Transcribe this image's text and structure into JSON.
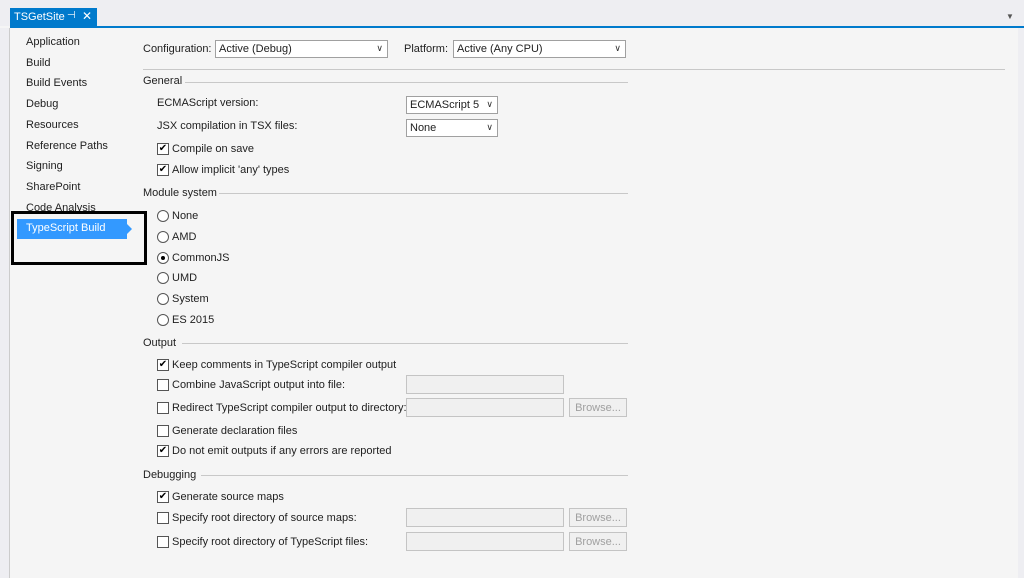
{
  "tab": {
    "title": "TSGetSite",
    "pin": "⊣",
    "close": "✕"
  },
  "sidebar": {
    "items": [
      "Application",
      "Build",
      "Build Events",
      "Debug",
      "Resources",
      "Reference Paths",
      "Signing",
      "SharePoint",
      "Code Analysis"
    ],
    "selected": "TypeScript Build"
  },
  "config": {
    "configuration_label": "Configuration:",
    "configuration_value": "Active (Debug)",
    "platform_label": "Platform:",
    "platform_value": "Active (Any CPU)"
  },
  "general": {
    "title": "General",
    "ecma_label": "ECMAScript version:",
    "ecma_value": "ECMAScript 5",
    "jsx_label": "JSX compilation in TSX files:",
    "jsx_value": "None",
    "compile_on_save": "Compile on save",
    "compile_on_save_checked": true,
    "implicit_any": "Allow implicit 'any' types",
    "implicit_any_checked": true
  },
  "module": {
    "title": "Module system",
    "options": [
      "None",
      "AMD",
      "CommonJS",
      "UMD",
      "System",
      "ES 2015"
    ],
    "selected": "CommonJS"
  },
  "output": {
    "title": "Output",
    "keep_comments": "Keep comments in TypeScript compiler output",
    "combine": "Combine JavaScript output into file:",
    "redirect": "Redirect TypeScript compiler output to directory:",
    "declaration": "Generate declaration files",
    "no_emit": "Do not emit outputs if any errors are reported",
    "browse": "Browse..."
  },
  "debugging": {
    "title": "Debugging",
    "source_maps": "Generate source maps",
    "root_maps": "Specify root directory of source maps:",
    "root_ts": "Specify root directory of TypeScript files:",
    "browse": "Browse..."
  },
  "colors": {
    "accent": "#007acc",
    "selected": "#3399ff"
  }
}
